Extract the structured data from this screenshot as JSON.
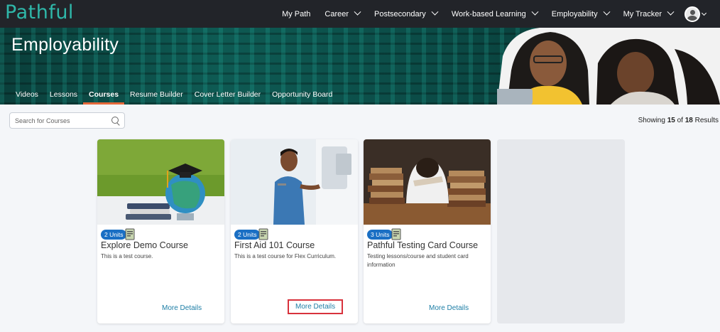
{
  "brand": {
    "logo_text": "Pathful",
    "logo_color": "#2fb7a9"
  },
  "nav": {
    "items": [
      {
        "label": "My Path",
        "dropdown": false
      },
      {
        "label": "Career",
        "dropdown": true
      },
      {
        "label": "Postsecondary",
        "dropdown": true
      },
      {
        "label": "Work-based Learning",
        "dropdown": true
      },
      {
        "label": "Employability",
        "dropdown": true
      },
      {
        "label": "My Tracker",
        "dropdown": true
      }
    ]
  },
  "hero": {
    "title": "Employability",
    "tabs": [
      {
        "label": "Videos",
        "active": false
      },
      {
        "label": "Lessons",
        "active": false
      },
      {
        "label": "Courses",
        "active": true
      },
      {
        "label": "Resume Builder",
        "active": false
      },
      {
        "label": "Cover Letter Builder",
        "active": false
      },
      {
        "label": "Opportunity Board",
        "active": false
      }
    ]
  },
  "search": {
    "placeholder": "Search for Courses",
    "value": ""
  },
  "results": {
    "prefix": "Showing",
    "shown": "15",
    "of": "of",
    "total": "18",
    "suffix": "Results"
  },
  "cards": [
    {
      "units": "2 Units",
      "title": "Explore Demo Course",
      "description": "This is a test course.",
      "action": "More Details",
      "highlighted": false
    },
    {
      "units": "2 Units",
      "title": "First Aid 101 Course",
      "description": "This is a test course for Flex Curriculum.",
      "action": "More Details",
      "highlighted": true
    },
    {
      "units": "3 Units",
      "title": "Pathful Testing Card Course",
      "description": "Testing lessons/course and student card information",
      "action": "More Details",
      "highlighted": false
    }
  ],
  "colors": {
    "accent_tab": "#e5683a",
    "badge": "#1a6fc4",
    "link": "#1d7ea6",
    "highlight_box": "#d8323c"
  }
}
